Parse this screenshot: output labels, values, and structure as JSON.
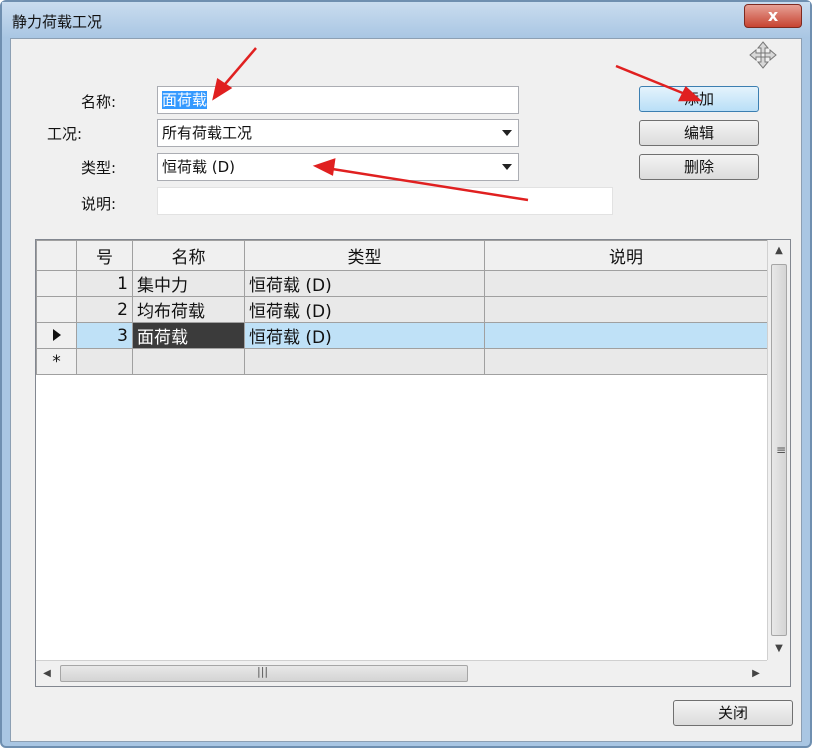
{
  "window": {
    "title": "静力荷载工况",
    "close_label": "x"
  },
  "form": {
    "name_label": "名称:",
    "name_value": "面荷载",
    "case_label": "工况:",
    "case_value": "所有荷载工况",
    "type_label": "类型:",
    "type_value": "恒荷载 (D)",
    "desc_label": "说明:",
    "desc_value": ""
  },
  "buttons": {
    "add": "添加",
    "edit": "编辑",
    "delete": "删除",
    "close": "关闭"
  },
  "grid": {
    "columns": [
      "号",
      "名称",
      "类型",
      "说明"
    ],
    "rows": [
      {
        "num": "1",
        "name": "集中力",
        "type": "恒荷载 (D)",
        "desc": ""
      },
      {
        "num": "2",
        "name": "均布荷载",
        "type": "恒荷载 (D)",
        "desc": ""
      },
      {
        "num": "3",
        "name": "面荷载",
        "type": "恒荷载 (D)",
        "desc": ""
      }
    ],
    "new_row_marker": "*",
    "current_row": 3
  },
  "colors": {
    "annotation_arrow": "#e02020",
    "selection": "#3399ff",
    "current_row": "#bfe1f7"
  }
}
